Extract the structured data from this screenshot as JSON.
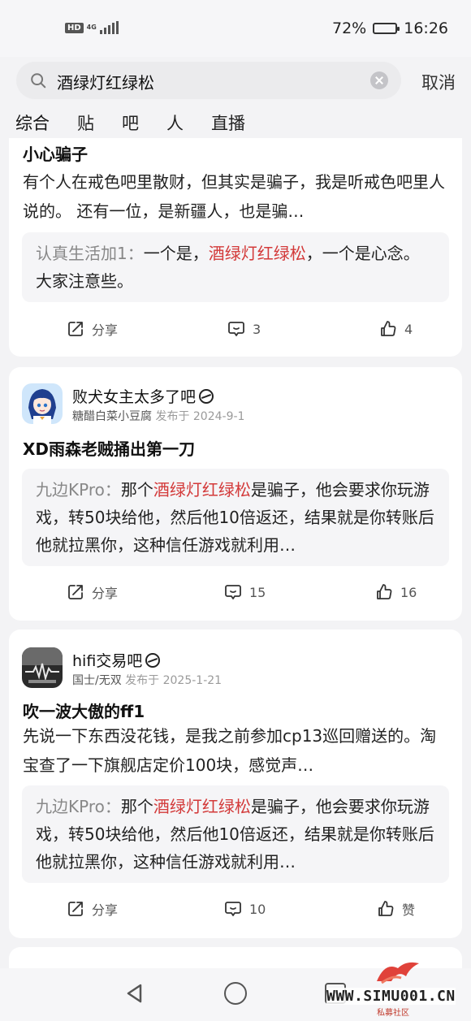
{
  "status_bar": {
    "hd": "HD",
    "network": "4G",
    "battery_text": "72%",
    "battery_level": 0.72,
    "time": "16:26"
  },
  "search": {
    "query": "酒绿灯红绿松",
    "cancel_label": "取消"
  },
  "tabs": [
    {
      "label": "综合",
      "active": true
    },
    {
      "label": "贴"
    },
    {
      "label": "吧"
    },
    {
      "label": "人"
    },
    {
      "label": "直播"
    }
  ],
  "posts": [
    {
      "title": "小心骗子",
      "body": "有个人在戒色吧里散财，但其实是骗子，我是听戒色吧里人说的。 还有一位，是新疆人，也是骗…",
      "comment": {
        "author": "认真生活加1：",
        "before": "一个是，",
        "highlight": "酒绿灯红绿松",
        "after": "，一个是心念。大家注意些。"
      },
      "share_label": "分享",
      "comments": "3",
      "likes": "4"
    },
    {
      "forum": "败犬女主太多了吧",
      "user": "糖醋白菜小豆腐",
      "meta": "发布于 2024-9-1",
      "title": "XD雨森老贼捅出第一刀",
      "comment": {
        "author": "九边KPro：",
        "before": "那个",
        "highlight": "酒绿灯红绿松",
        "after": "是骗子，他会要求你玩游戏，转50块给他，然后他10倍返还，结果就是你转账后他就拉黑你，这种信任游戏就利用…"
      },
      "share_label": "分享",
      "comments": "15",
      "likes": "16"
    },
    {
      "forum": "hifi交易吧",
      "user": "国士/无双",
      "meta": "发布于 2025-1-21",
      "title": "吹一波大傲的ff1",
      "body": "先说一下东西没花钱，是我之前参加cp13巡回赠送的。淘宝查了一下旗舰店定价100块，感觉声…",
      "comment": {
        "author": "九边KPro：",
        "before": "那个",
        "highlight": "酒绿灯红绿松",
        "after": "是骗子，他会要求你玩游戏，转50块给他，然后他10倍返还，结果就是你转账后他就拉黑你，这种信任游戏就利用…"
      },
      "share_label": "分享",
      "comments": "10",
      "likes": "赞"
    }
  ],
  "watermark": {
    "text": "WWW.SIMU001.CN",
    "sub": "私募社区"
  },
  "colors": {
    "highlight": "#d33a3a",
    "tab_indicator": "#6a4cff",
    "background": "#f3f3f5"
  }
}
